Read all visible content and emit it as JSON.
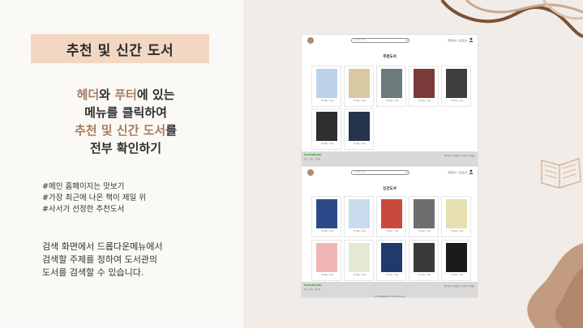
{
  "slide": {
    "title": "추천 및 신간 도서",
    "highlight": {
      "l1a": "헤더",
      "l1b": "와 ",
      "l1c": "푸터",
      "l1d": "에 있는",
      "line2": "메뉴를 클릭하여",
      "l3a": "추천 및 신간 도서",
      "l3b": "를",
      "line4": "전부 확인하기"
    },
    "hashtags": [
      "#메인 홈페이지는 맛보기",
      "#가장 최근에 나온 책이 제일 위",
      "#사서가 선정한 추천도서"
    ],
    "desc": [
      "검색 화면에서 드롭다운메뉴에서",
      "검색할 주제를 정하여 도서관의",
      "도서를 검색할 수 있습니다."
    ],
    "colors": {
      "accent": "#a87c5f",
      "title_bg": "#f3d7c4",
      "right_bg": "#f1ece8"
    }
  },
  "screens": {
    "recommend": {
      "heading": "추천도서",
      "search_placeholder": "검색어 입력",
      "menu": [
        "추천도서",
        "신간도서"
      ],
      "books": [
        {
          "title": "책 제목 / 저자",
          "color": "#bcd3ea"
        },
        {
          "title": "책 제목 / 저자",
          "color": "#d9c9a3"
        },
        {
          "title": "책 제목 / 저자",
          "color": "#6b7b7c"
        },
        {
          "title": "책 제목 / 저자",
          "color": "#7b3b3b"
        },
        {
          "title": "책 제목 / 저자",
          "color": "#3e3e3e"
        },
        {
          "title": "책 제목 / 저자",
          "color": "#2f2f2f"
        },
        {
          "title": "책 제목 / 저자",
          "color": "#25344a"
        }
      ],
      "footer": {
        "logo": "BOOKBRAND",
        "info": "주소 · 대표 · 연락처",
        "links": "이용약관 | 개인정보 | 저작권 | 이메일",
        "copy": "© BOOKBRAND All rights reserved"
      }
    },
    "new": {
      "heading": "신간도서",
      "search_placeholder": "검색어 입력",
      "menu": [
        "추천도서",
        "신간도서"
      ],
      "books": [
        {
          "title": "책 제목 / 저자",
          "color": "#2c4a8a"
        },
        {
          "title": "책 제목 / 저자",
          "color": "#c9dcee"
        },
        {
          "title": "책 제목 / 저자",
          "color": "#c94a3c"
        },
        {
          "title": "책 제목 / 저자",
          "color": "#6e6e6e"
        },
        {
          "title": "책 제목 / 저자",
          "color": "#e6dfb0"
        },
        {
          "title": "책 제목 / 저자",
          "color": "#f0b6b6"
        },
        {
          "title": "책 제목 / 저자",
          "color": "#e4e9d3"
        },
        {
          "title": "책 제목 / 저자",
          "color": "#1f3a6b"
        },
        {
          "title": "책 제목 / 저자",
          "color": "#3a3a3a"
        },
        {
          "title": "책 제목 / 저자",
          "color": "#1b1b1b"
        }
      ],
      "footer": {
        "logo": "BOOKBRAND",
        "info": "주소 · 대표 · 연락처",
        "links": "이용약관 | 개인정보 | 저작권 | 이메일",
        "copy": "© BOOKBRAND All rights reserved"
      }
    }
  }
}
